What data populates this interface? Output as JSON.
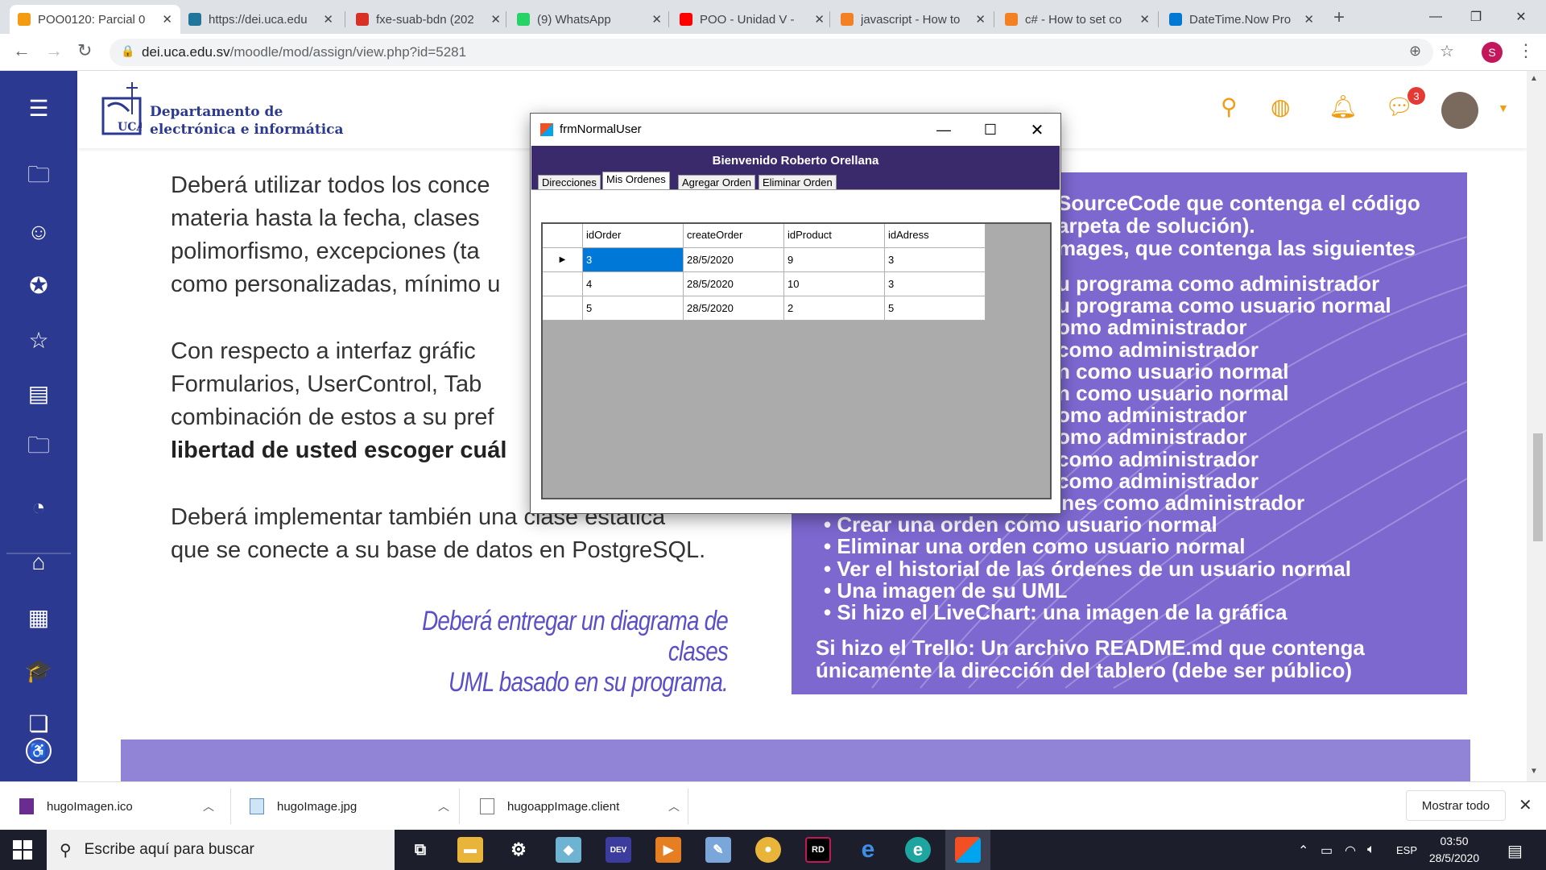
{
  "browser": {
    "tabs": [
      {
        "title": "POO0120: Parcial 0",
        "active": true,
        "fav_color": "#f39c12",
        "fav_icon": "moodle-icon"
      },
      {
        "title": "https://dei.uca.edu",
        "active": false,
        "fav_color": "#21759b",
        "fav_icon": "wordpress-icon"
      },
      {
        "title": "fxe-suab-bdn (202",
        "active": false,
        "fav_color": "#d93025",
        "fav_icon": "calendar-icon"
      },
      {
        "title": "(9) WhatsApp",
        "active": false,
        "fav_color": "#25d366",
        "fav_icon": "whatsapp-icon"
      },
      {
        "title": "POO - Unidad V - ",
        "active": false,
        "fav_color": "#ff0000",
        "fav_icon": "youtube-icon"
      },
      {
        "title": "javascript - How to",
        "active": false,
        "fav_color": "#f48024",
        "fav_icon": "stackoverflow-icon"
      },
      {
        "title": "c# - How to set co",
        "active": false,
        "fav_color": "#f48024",
        "fav_icon": "stackoverflow-icon"
      },
      {
        "title": "DateTime.Now Pro",
        "active": false,
        "fav_color": "#0078d4",
        "fav_icon": "microsoft-icon"
      }
    ],
    "url_host": "dei.uca.edu.sv",
    "url_path": "/moodle/mod/assign/view.php?id=5281",
    "profile_initial": "S"
  },
  "site": {
    "logo_line1": "Departamento de",
    "logo_line2": "electrónica e informática",
    "logo_mark_text": "UCA",
    "message_badge": "3"
  },
  "content": {
    "para1": [
      "Deberá utilizar todos los conce",
      "materia hasta la fecha, clases",
      "polimorfismo, excepciones (ta",
      "como personalizadas, mínimo u"
    ],
    "para2": [
      "Con respecto a interfaz gráfic",
      "Formularios, UserControl, Tab",
      "combinación de estos a su pref"
    ],
    "para2_bold": "libertad de usted escoger cuál",
    "para3": [
      "Deberá implementar también una clase estática",
      "que se conecte a su base de datos en PostgreSQL."
    ],
    "quote_line1": "Deberá entregar un diagrama de clases",
    "quote_line2": "UML basado en su programa.",
    "box_top": [
      "SourceCode que contenga el código",
      "arpeta de solución).",
      "mages, que contenga las siguientes"
    ],
    "box_items": [
      "u programa como administrador",
      "u programa como usuario normal",
      "omo administrador",
      "como administrador",
      "n como usuario normal",
      "n como usuario normal",
      "omo administrador",
      "omo administrador",
      " como administrador",
      " como administrador",
      "Ver el historial de órdenes como administrador",
      "Crear una orden como usuario normal",
      "Eliminar una orden como usuario normal",
      "Ver el historial de las órdenes de un usuario normal",
      "Una imagen de su UML",
      "Si hizo el LiveChart: una imagen de la gráfica"
    ],
    "box_bottom": [
      "Si hizo el Trello: Un archivo README.md que contenga",
      "únicamente la dirección del tablero (debe ser público)"
    ]
  },
  "app_window": {
    "title": "frmNormalUser",
    "welcome": "Bienvenido Roberto Orellana",
    "tabs": [
      "Direcciones",
      "Mis Ordenes",
      "Agregar Orden",
      "Eliminar Orden"
    ],
    "selected_tab": "Mis Ordenes",
    "grid": {
      "columns": [
        "idOrder",
        "createOrder",
        "idProduct",
        "idAdress"
      ],
      "rows": [
        [
          "3",
          "28/5/2020",
          "9",
          "3"
        ],
        [
          "4",
          "28/5/2020",
          "10",
          "3"
        ],
        [
          "5",
          "28/5/2020",
          "2",
          "5"
        ]
      ]
    }
  },
  "downloads": {
    "items": [
      "hugoImagen.ico",
      "hugoImage.jpg",
      "hugoappImage.client"
    ],
    "show_all": "Mostrar todo"
  },
  "taskbar": {
    "search_placeholder": "Escribe aquí para buscar",
    "language": "ESP",
    "time": "03:50",
    "date": "28/5/2020"
  }
}
